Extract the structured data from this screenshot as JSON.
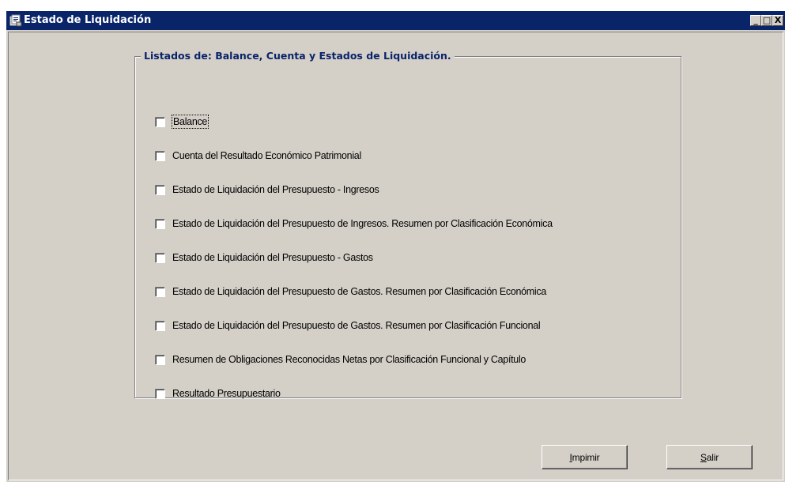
{
  "window": {
    "title": "Estado de Liquidación",
    "minimize_glyph": "_",
    "maximize_glyph": "□",
    "close_glyph": "X",
    "titlebar_color": "#0a246a",
    "face_color": "#d4d0c8"
  },
  "group": {
    "legend": "Listados de: Balance, Cuenta y Estados de Liquidación."
  },
  "checkboxes": [
    {
      "label": "Balance",
      "checked": false
    },
    {
      "label": "Cuenta del Resultado Económico Patrimonial",
      "checked": false
    },
    {
      "label": "Estado de Liquidación del Presupuesto - Ingresos",
      "checked": false
    },
    {
      "label": "Estado de Liquidación del Presupuesto de Ingresos. Resumen por Clasificación Económica",
      "checked": false
    },
    {
      "label": "Estado de Liquidación del Presupuesto - Gastos",
      "checked": false
    },
    {
      "label": "Estado de Liquidación del Presupuesto de Gastos. Resumen por Clasificación Económica",
      "checked": false
    },
    {
      "label": "Estado de Liquidación del Presupuesto de Gastos. Resumen por Clasificación Funcional",
      "checked": false
    },
    {
      "label": "Resumen de Obligaciones Reconocidas Netas por Clasificación Funcional y Capítulo",
      "checked": false
    },
    {
      "label": "Resultado Presupuestario",
      "checked": false
    }
  ],
  "buttons": {
    "print_label_first": "I",
    "print_label_rest": "mpimir",
    "exit_label_first": "S",
    "exit_label_rest": "alir"
  }
}
